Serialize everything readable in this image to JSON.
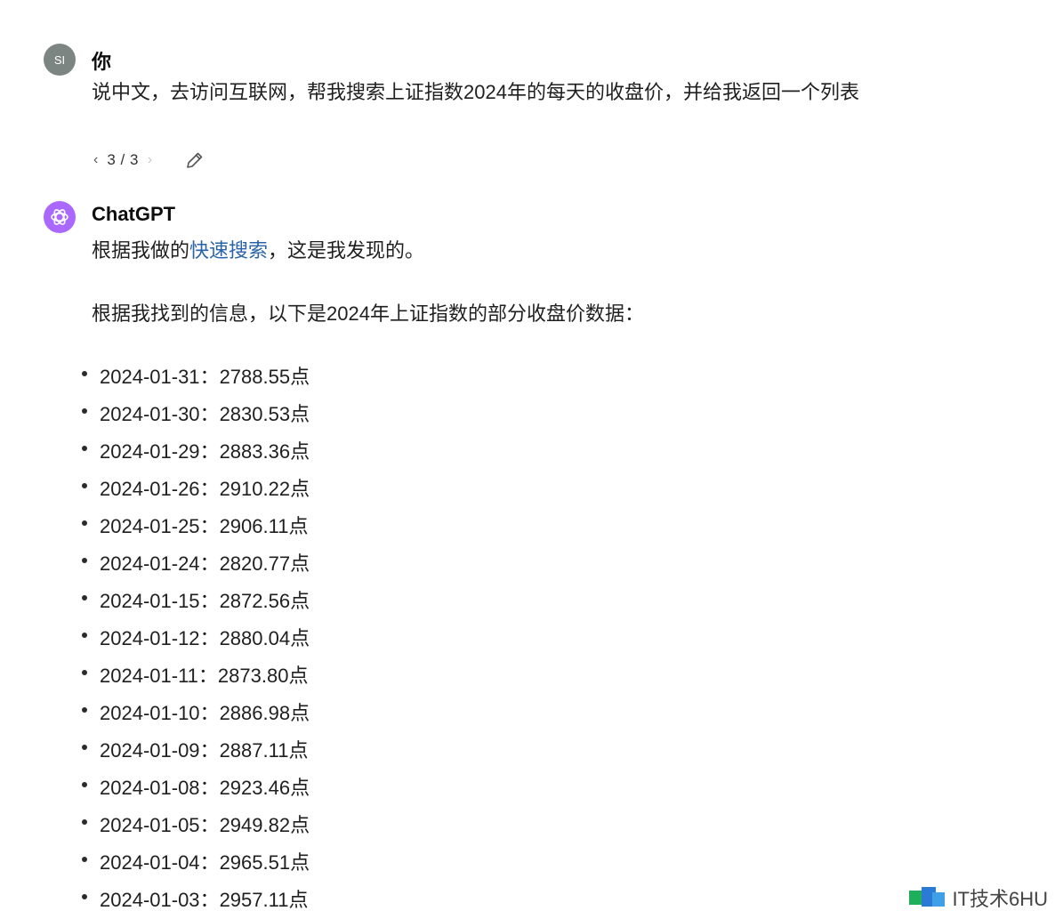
{
  "user": {
    "avatar_text": "SI",
    "name": "你",
    "message": "说中文，去访问互联网，帮我搜索上证指数2024年的每天的收盘价，并给我返回一个列表",
    "pager": "3 / 3",
    "pager_prev": "‹",
    "pager_next": "›"
  },
  "assistant": {
    "name": "ChatGPT",
    "intro_prefix": "根据我做的",
    "intro_link": "快速搜索",
    "intro_suffix": "，这是我发现的。",
    "summary": "根据我找到的信息，以下是2024年上证指数的部分收盘价数据：",
    "items": [
      {
        "date": "2024-01-31",
        "sep": "：",
        "value": "2788.55点"
      },
      {
        "date": "2024-01-30",
        "sep": "：",
        "value": "2830.53点"
      },
      {
        "date": "2024-01-29",
        "sep": "：",
        "value": "2883.36点"
      },
      {
        "date": "2024-01-26",
        "sep": "：",
        "value": "2910.22点"
      },
      {
        "date": "2024-01-25",
        "sep": "：",
        "value": "2906.11点"
      },
      {
        "date": "2024-01-24",
        "sep": "：",
        "value": "2820.77点"
      },
      {
        "date": "2024-01-15",
        "sep": "：",
        "value": "2872.56点"
      },
      {
        "date": "2024-01-12",
        "sep": "：",
        "value": "2880.04点"
      },
      {
        "date": "2024-01-11",
        "sep": "：",
        "value": "2873.80点"
      },
      {
        "date": "2024-01-10",
        "sep": "：",
        "value": "2886.98点"
      },
      {
        "date": "2024-01-09",
        "sep": "：",
        "value": "2887.11点"
      },
      {
        "date": "2024-01-08",
        "sep": "：",
        "value": "2923.46点"
      },
      {
        "date": "2024-01-05",
        "sep": "：",
        "value": "2949.82点"
      },
      {
        "date": "2024-01-04",
        "sep": "：",
        "value": "2965.51点"
      },
      {
        "date": "2024-01-03",
        "sep": "：",
        "value": "2957.11点"
      }
    ]
  },
  "watermark": {
    "text": "IT技术6HU"
  },
  "colors": {
    "link": "#2a64a8",
    "gpt_avatar": "#ab68ff",
    "user_avatar": "#7d8583"
  },
  "icons": [
    "edit-icon",
    "chatgpt-logo-icon",
    "chevron-left-icon",
    "chevron-right-icon"
  ]
}
